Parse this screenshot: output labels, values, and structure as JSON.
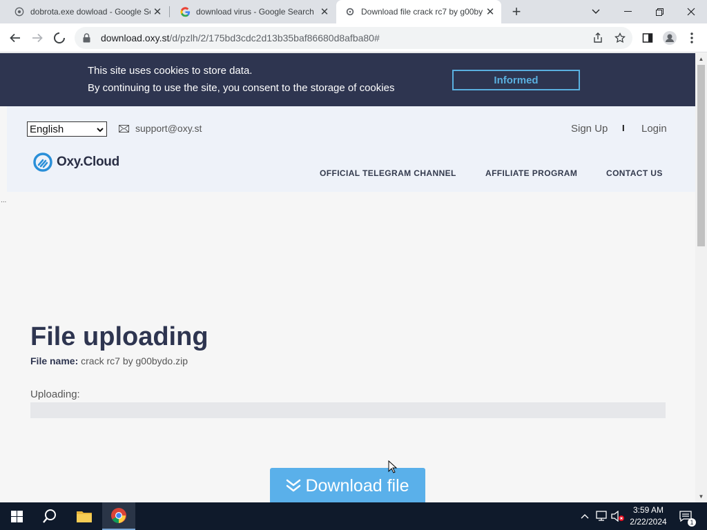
{
  "browser": {
    "tabs": [
      {
        "title": "dobrota.exe dowload - Google Se",
        "icon": "globe-icon",
        "active": false
      },
      {
        "title": "download virus - Google Search",
        "icon": "google-icon",
        "active": false
      },
      {
        "title": "Download file crack rc7 by g00by",
        "icon": "loading-icon",
        "active": true
      }
    ],
    "url_host": "download.oxy.st",
    "url_path": "/d/pzlh/2/175bd3cdc2d13b35baf86680d8afba80#"
  },
  "cookie_bar": {
    "line1": "This site uses cookies to store data.",
    "line2": "By continuing to use the site, you consent to the storage of cookies",
    "button": "Informed"
  },
  "header": {
    "language": "English",
    "support_email": "support@oxy.st",
    "signup": "Sign Up",
    "divider": "I",
    "login": "Login",
    "logo_text": "Oxy.Cloud",
    "nav": [
      "OFFICIAL TELEGRAM CHANNEL",
      "AFFILIATE PROGRAM",
      "CONTACT US"
    ]
  },
  "main": {
    "ellipsis": "...",
    "heading": "File uploading",
    "file_name_label": "File name:",
    "file_name": "crack rc7 by g00bydo.zip",
    "uploading_label": "Uploading:",
    "progress_fraction": 0,
    "download_button": "Download file"
  },
  "taskbar": {
    "time": "3:59 AM",
    "date": "2/22/2024",
    "notification_count": "1"
  },
  "colors": {
    "cookie_bg": "#2e3550",
    "accent": "#5ab0ea",
    "taskbar_bg": "#0f1a2b"
  }
}
